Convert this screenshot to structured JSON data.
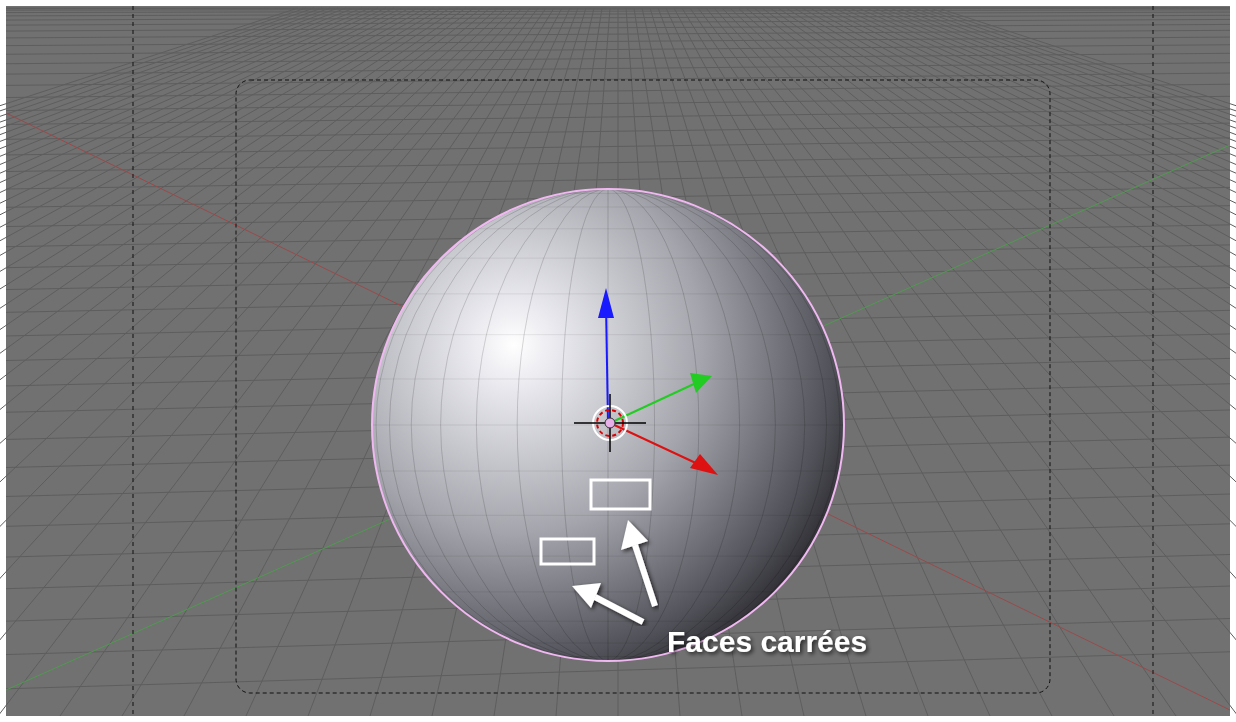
{
  "viewport": {
    "annotation": {
      "label": "Faces carrées"
    }
  }
}
